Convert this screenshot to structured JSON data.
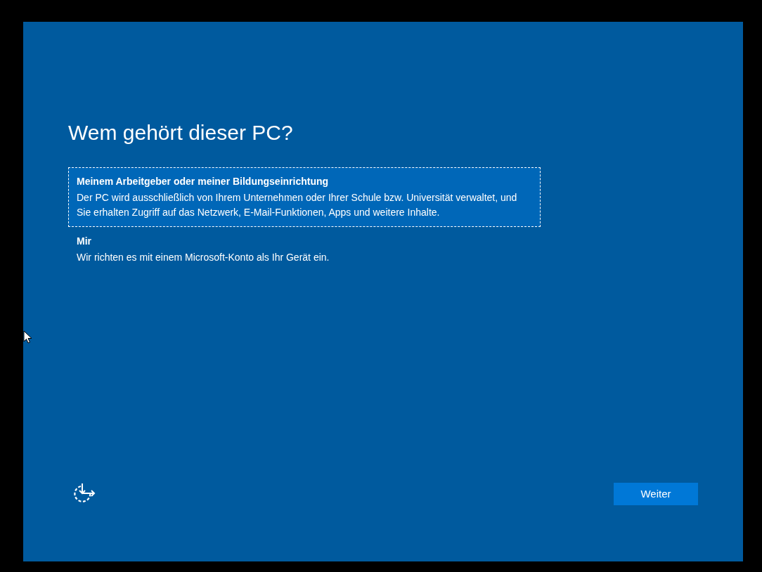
{
  "title": "Wem gehört dieser PC?",
  "options": [
    {
      "label": "Meinem Arbeitgeber oder meiner Bildungseinrichtung",
      "description": "Der PC wird ausschließlich von Ihrem Unternehmen oder Ihrer Schule bzw. Universität verwaltet, und Sie erhalten Zugriff auf das Netzwerk, E-Mail-Funktionen, Apps und weitere Inhalte.",
      "selected": true
    },
    {
      "label": "Mir",
      "description": "Wir richten es mit einem Microsoft-Konto als Ihr Gerät ein.",
      "selected": false
    }
  ],
  "next_button": "Weiter"
}
